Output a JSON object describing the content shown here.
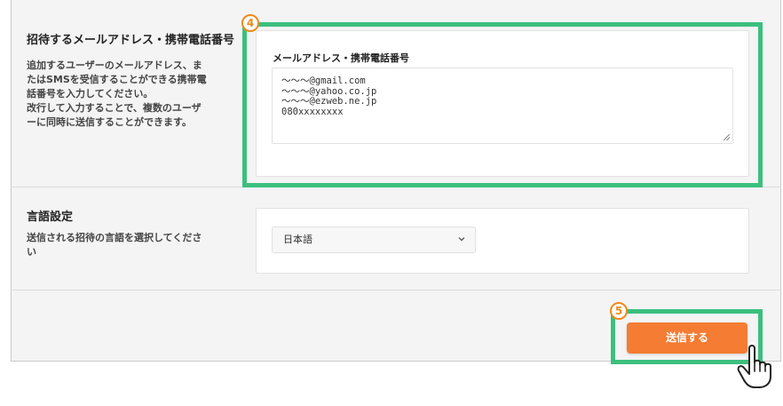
{
  "invite_section": {
    "title": "招待するメールアドレス・携帯電話番号",
    "description_lines": [
      "追加するユーザーのメールアドレス、ま",
      "たはSMSを受信することができる携帯電",
      "話番号を入力してください。",
      "改行して入力することで、複数のユーザ",
      "ーに同時に送信することができます。"
    ],
    "field_label": "メールアドレス・携帯電話番号",
    "textarea_lines": [
      "〜〜〜@gmail.com",
      "〜〜〜@yahoo.co.jp",
      "〜〜〜@ezweb.ne.jp",
      "080xxxxxxxx"
    ]
  },
  "language_section": {
    "title": "言語設定",
    "description_lines": [
      "送信される招待の言語を選択してくださ",
      "い"
    ],
    "selected_value": "日本語"
  },
  "submit": {
    "label": "送信する"
  },
  "steps": {
    "step4": "4",
    "step5": "5"
  },
  "colors": {
    "highlight_green": "#3cbf7f",
    "badge_orange": "#f08a1c",
    "button_orange": "#f47c33",
    "panel_bg": "#f4f4f4"
  },
  "icons": {
    "select_arrow": "chevron-down-icon",
    "cursor": "hand-pointer-icon",
    "resize": "resize-handle-icon"
  }
}
